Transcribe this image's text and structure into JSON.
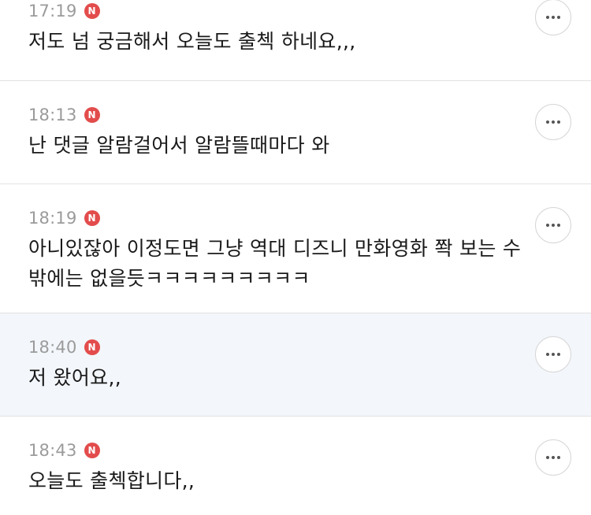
{
  "comments": [
    {
      "time": "17:19",
      "badge": "N",
      "text": "저도 넘 궁금해서 오늘도 출첵 하네요,,,",
      "highlighted": false
    },
    {
      "time": "18:13",
      "badge": "N",
      "text": "난 댓글 알람걸어서 알람뜰때마다 와",
      "highlighted": false
    },
    {
      "time": "18:19",
      "badge": "N",
      "text": "아니있잖아 이정도면 그냥 역대 디즈니 만화영화 쫙 보는 수 밖에는 없을듯ㅋㅋㅋㅋㅋㅋㅋㅋㅋ",
      "highlighted": false
    },
    {
      "time": "18:40",
      "badge": "N",
      "text": "저 왔어요,,",
      "highlighted": true
    },
    {
      "time": "18:43",
      "badge": "N",
      "text": "오늘도 출첵합니다,,",
      "highlighted": false
    }
  ],
  "icons": {
    "more": "more-horizontal-icon",
    "badge": "new-badge-icon"
  },
  "colors": {
    "badge": "#e34c4c",
    "highlight_background": "#f3f6fa",
    "time": "#9b9b9b",
    "text": "#1a1a1a"
  }
}
